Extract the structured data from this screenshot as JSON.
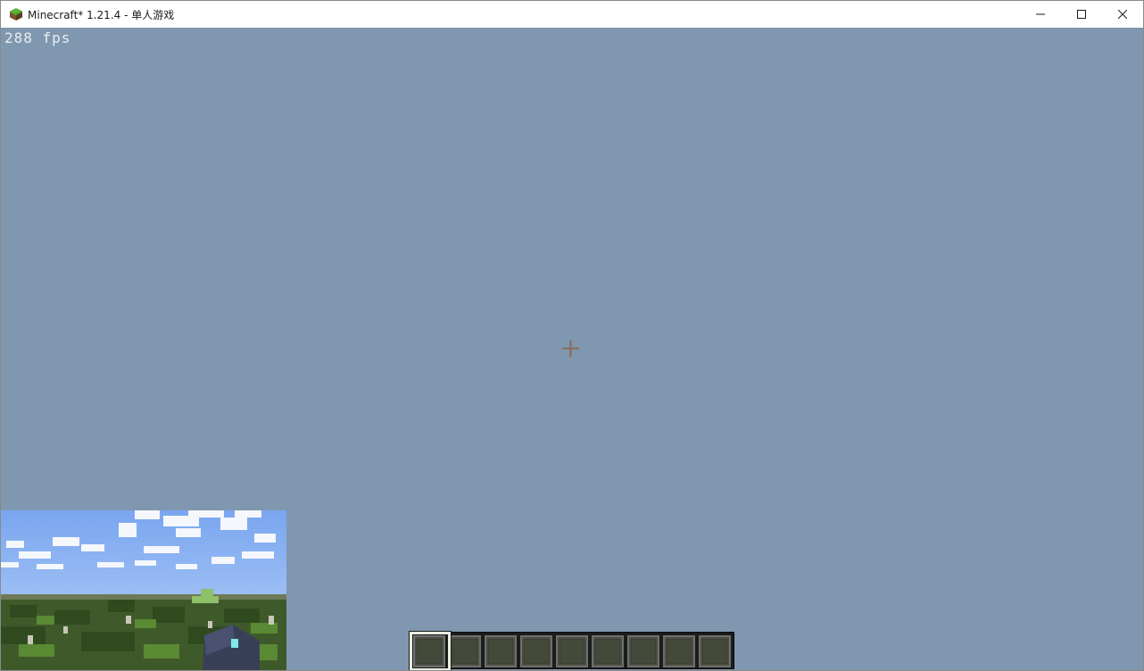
{
  "window": {
    "title": "Minecraft* 1.21.4 - 单人游戏",
    "app_icon": "grass-block-icon",
    "controls": [
      "minimize-icon",
      "maximize-icon",
      "close-icon"
    ]
  },
  "hud": {
    "fps_text": "288 fps",
    "crosshair_icon": "crosshair-icon",
    "hotbar": {
      "slot_count": 9,
      "selected_slot": 1
    }
  },
  "pip_preview": {
    "description_icon": "world-preview-thumbnail"
  },
  "colors": {
    "sky": "#7f98b0",
    "titlebar": "#ffffff",
    "fps_text": "#e8ecf2",
    "crosshair": "#8b6a5a",
    "hotbar_bg": "#1c1c1c",
    "slot_fill": "#434a3a",
    "selected_border": "#e8ecdf"
  }
}
